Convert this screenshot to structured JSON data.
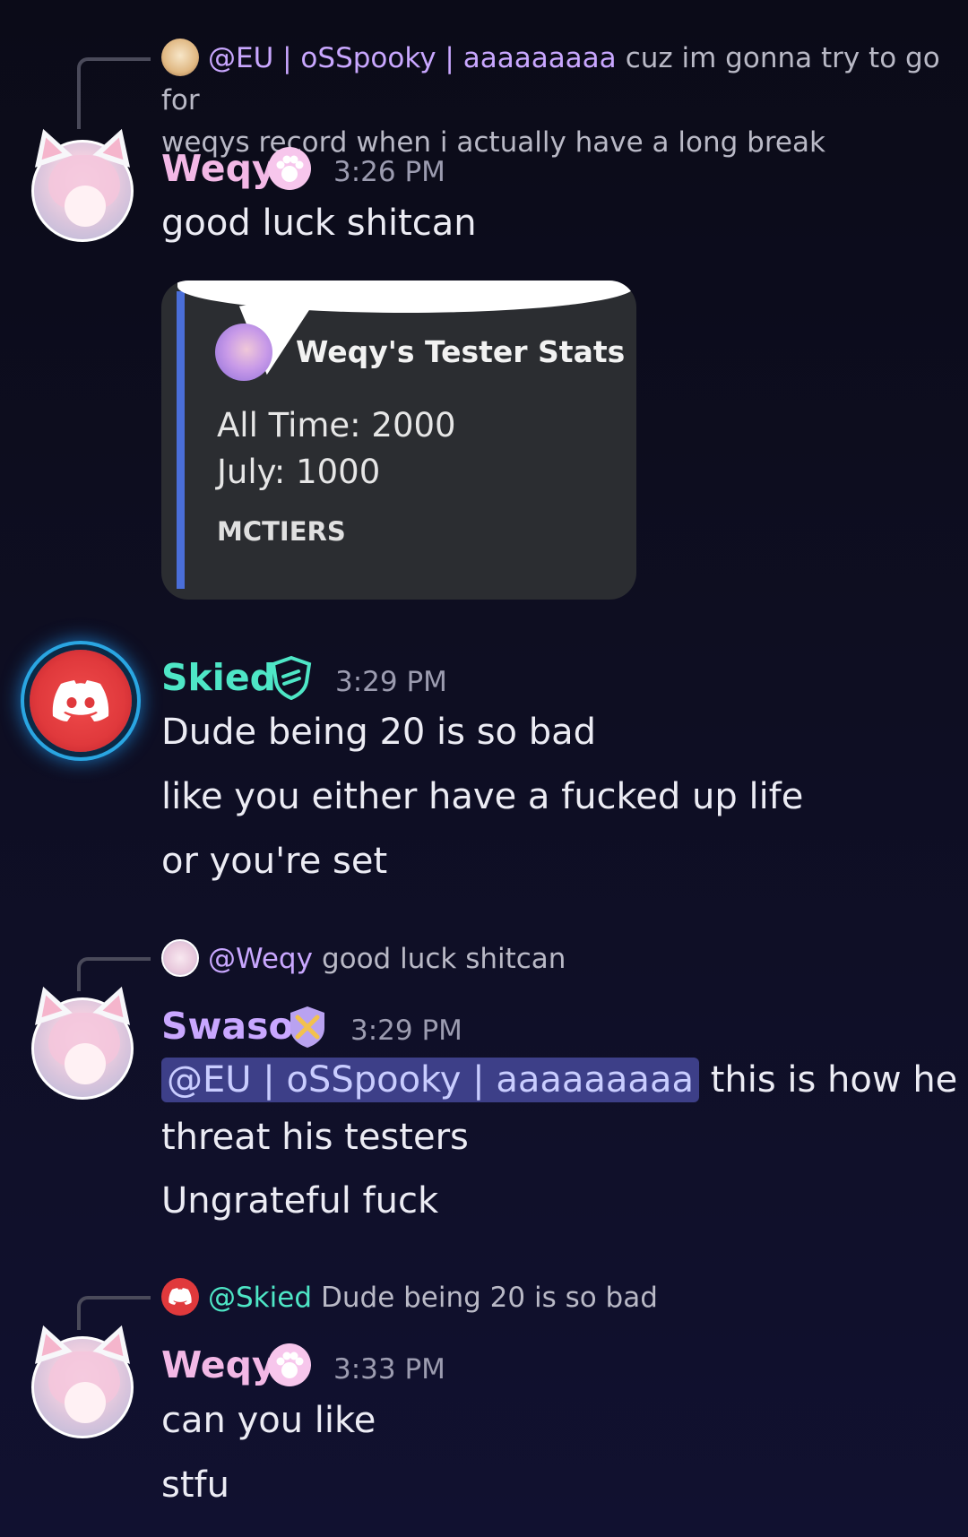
{
  "messages": [
    {
      "reply": {
        "mention": "@EU | oSSpooky | aaaaaaaaa",
        "text_line1": "cuz im gonna try to go for",
        "text_line2": "weqys record when i actually have a long break"
      },
      "author": "Weqy",
      "author_color": "#f3b8e6",
      "timestamp": "3:26 PM",
      "lines": [
        "good luck shitcan"
      ],
      "embed": {
        "title": "Weqy's Tester Stats",
        "all_time": "All Time: 2000",
        "july": "July: 1000",
        "footer": "MCTIERS"
      }
    },
    {
      "author": "Skied",
      "author_color": "#4ee6c6",
      "timestamp": "3:29 PM",
      "lines": [
        "Dude being 20 is so bad",
        "like you either have a fucked up life",
        "or you're set"
      ]
    },
    {
      "reply": {
        "mention": "@Weqy",
        "text": "good luck shitcan"
      },
      "author": "Swaso",
      "author_color": "#c9a7ff",
      "timestamp": "3:29 PM",
      "mention": "@EU | oSSpooky | aaaaaaaaa",
      "lines": [
        "this is how he",
        "threat his testers",
        "Ungrateful fuck"
      ]
    },
    {
      "reply": {
        "mention": "@Skied",
        "text": "Dude being 20 is so bad"
      },
      "author": "Weqy",
      "author_color": "#f3b8e6",
      "timestamp": "3:33 PM",
      "lines": [
        "can you like",
        "stfu"
      ]
    }
  ]
}
